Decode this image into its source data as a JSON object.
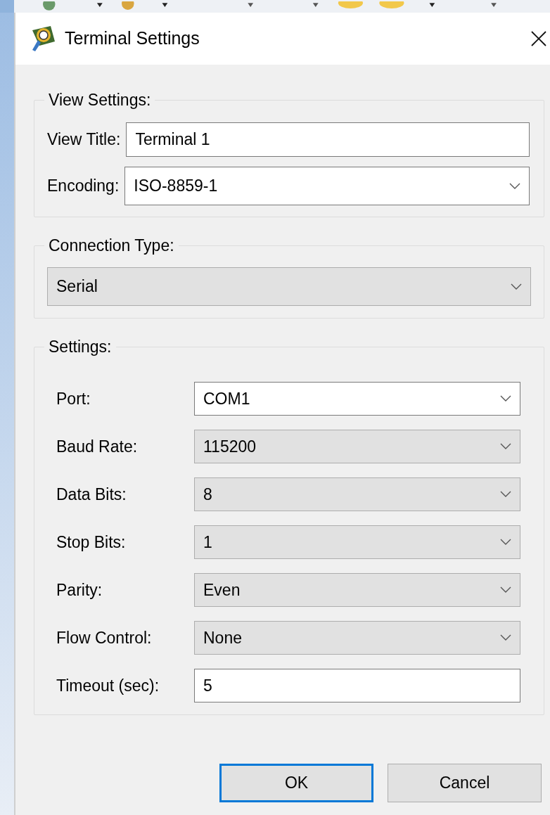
{
  "window": {
    "title": "Terminal Settings"
  },
  "groups": [
    {
      "title": "View Settings:",
      "kind": "compact",
      "fields": [
        {
          "label": "View Title:",
          "kind": "text",
          "value": "Terminal 1"
        },
        {
          "label": "Encoding:",
          "kind": "dropdown",
          "editable": true,
          "value": "ISO-8859-1"
        }
      ]
    },
    {
      "title": "Connection Type:",
      "kind": "full",
      "fields": [
        {
          "kind": "dropdown",
          "editable": false,
          "value": "Serial"
        }
      ]
    },
    {
      "title": "Settings:",
      "kind": "wide",
      "fields": [
        {
          "label": "Port:",
          "kind": "dropdown",
          "editable": true,
          "value": "COM1"
        },
        {
          "label": "Baud Rate:",
          "kind": "dropdown",
          "editable": false,
          "value": "115200"
        },
        {
          "label": "Data Bits:",
          "kind": "dropdown",
          "editable": false,
          "value": "8"
        },
        {
          "label": "Stop Bits:",
          "kind": "dropdown",
          "editable": false,
          "value": "1"
        },
        {
          "label": "Parity:",
          "kind": "dropdown",
          "editable": false,
          "value": "Even"
        },
        {
          "label": "Flow Control:",
          "kind": "dropdown",
          "editable": false,
          "value": "None"
        },
        {
          "label": "Timeout (sec):",
          "kind": "text",
          "value": "5"
        }
      ]
    }
  ],
  "buttons": [
    {
      "label": "OK",
      "default": true
    },
    {
      "label": "Cancel",
      "default": false
    }
  ]
}
